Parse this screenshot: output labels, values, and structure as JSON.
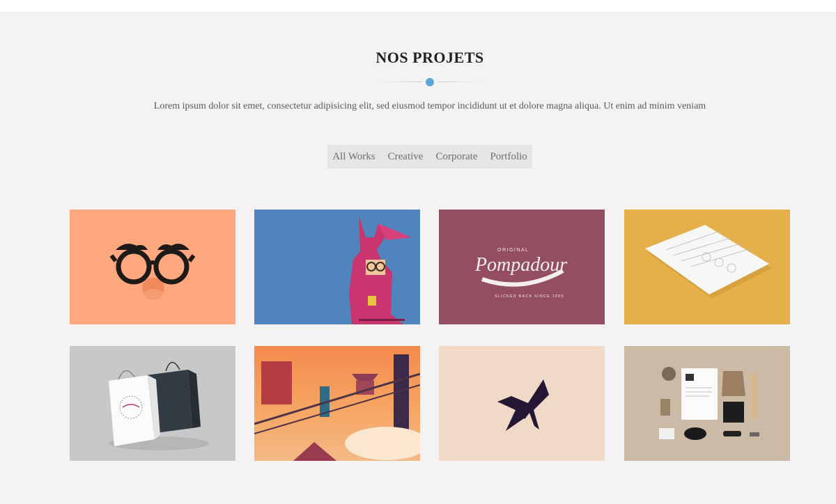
{
  "section": {
    "title": "NOS PROJETS",
    "lead": "Lorem ipsum dolor sit emet, consectetur adipisicing elit, sed eiusmod tempor incididunt ut et dolore magna aliqua. Ut enim ad minim veniam",
    "accent_color": "#5aa6d6"
  },
  "filters": [
    "All Works",
    "Creative",
    "Corporate",
    "Portfolio"
  ],
  "portfolio": {
    "pompadour_logo": {
      "top": "ORIGINAL",
      "name": "Pompadour",
      "bottom": "SLICKED BACK SINCE 1955"
    }
  }
}
